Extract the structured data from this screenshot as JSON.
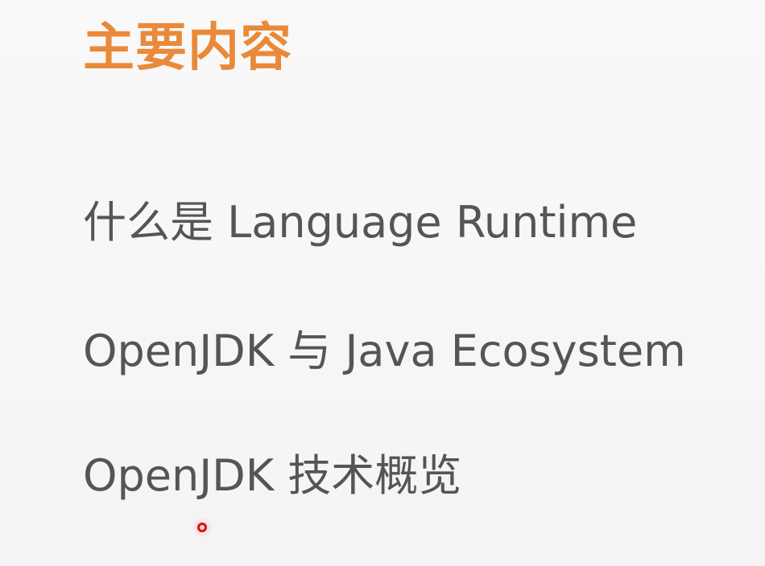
{
  "slide": {
    "title": "主要内容",
    "items": [
      "什么是 Language Runtime",
      "OpenJDK 与 Java Ecosystem",
      "OpenJDK 技术概览"
    ]
  },
  "colors": {
    "title": "#e98a3a",
    "body_text": "#555555",
    "background": "#f7f7f7",
    "pointer": "#e02020"
  },
  "icons": {
    "pointer": "red-dot-pointer-icon"
  }
}
